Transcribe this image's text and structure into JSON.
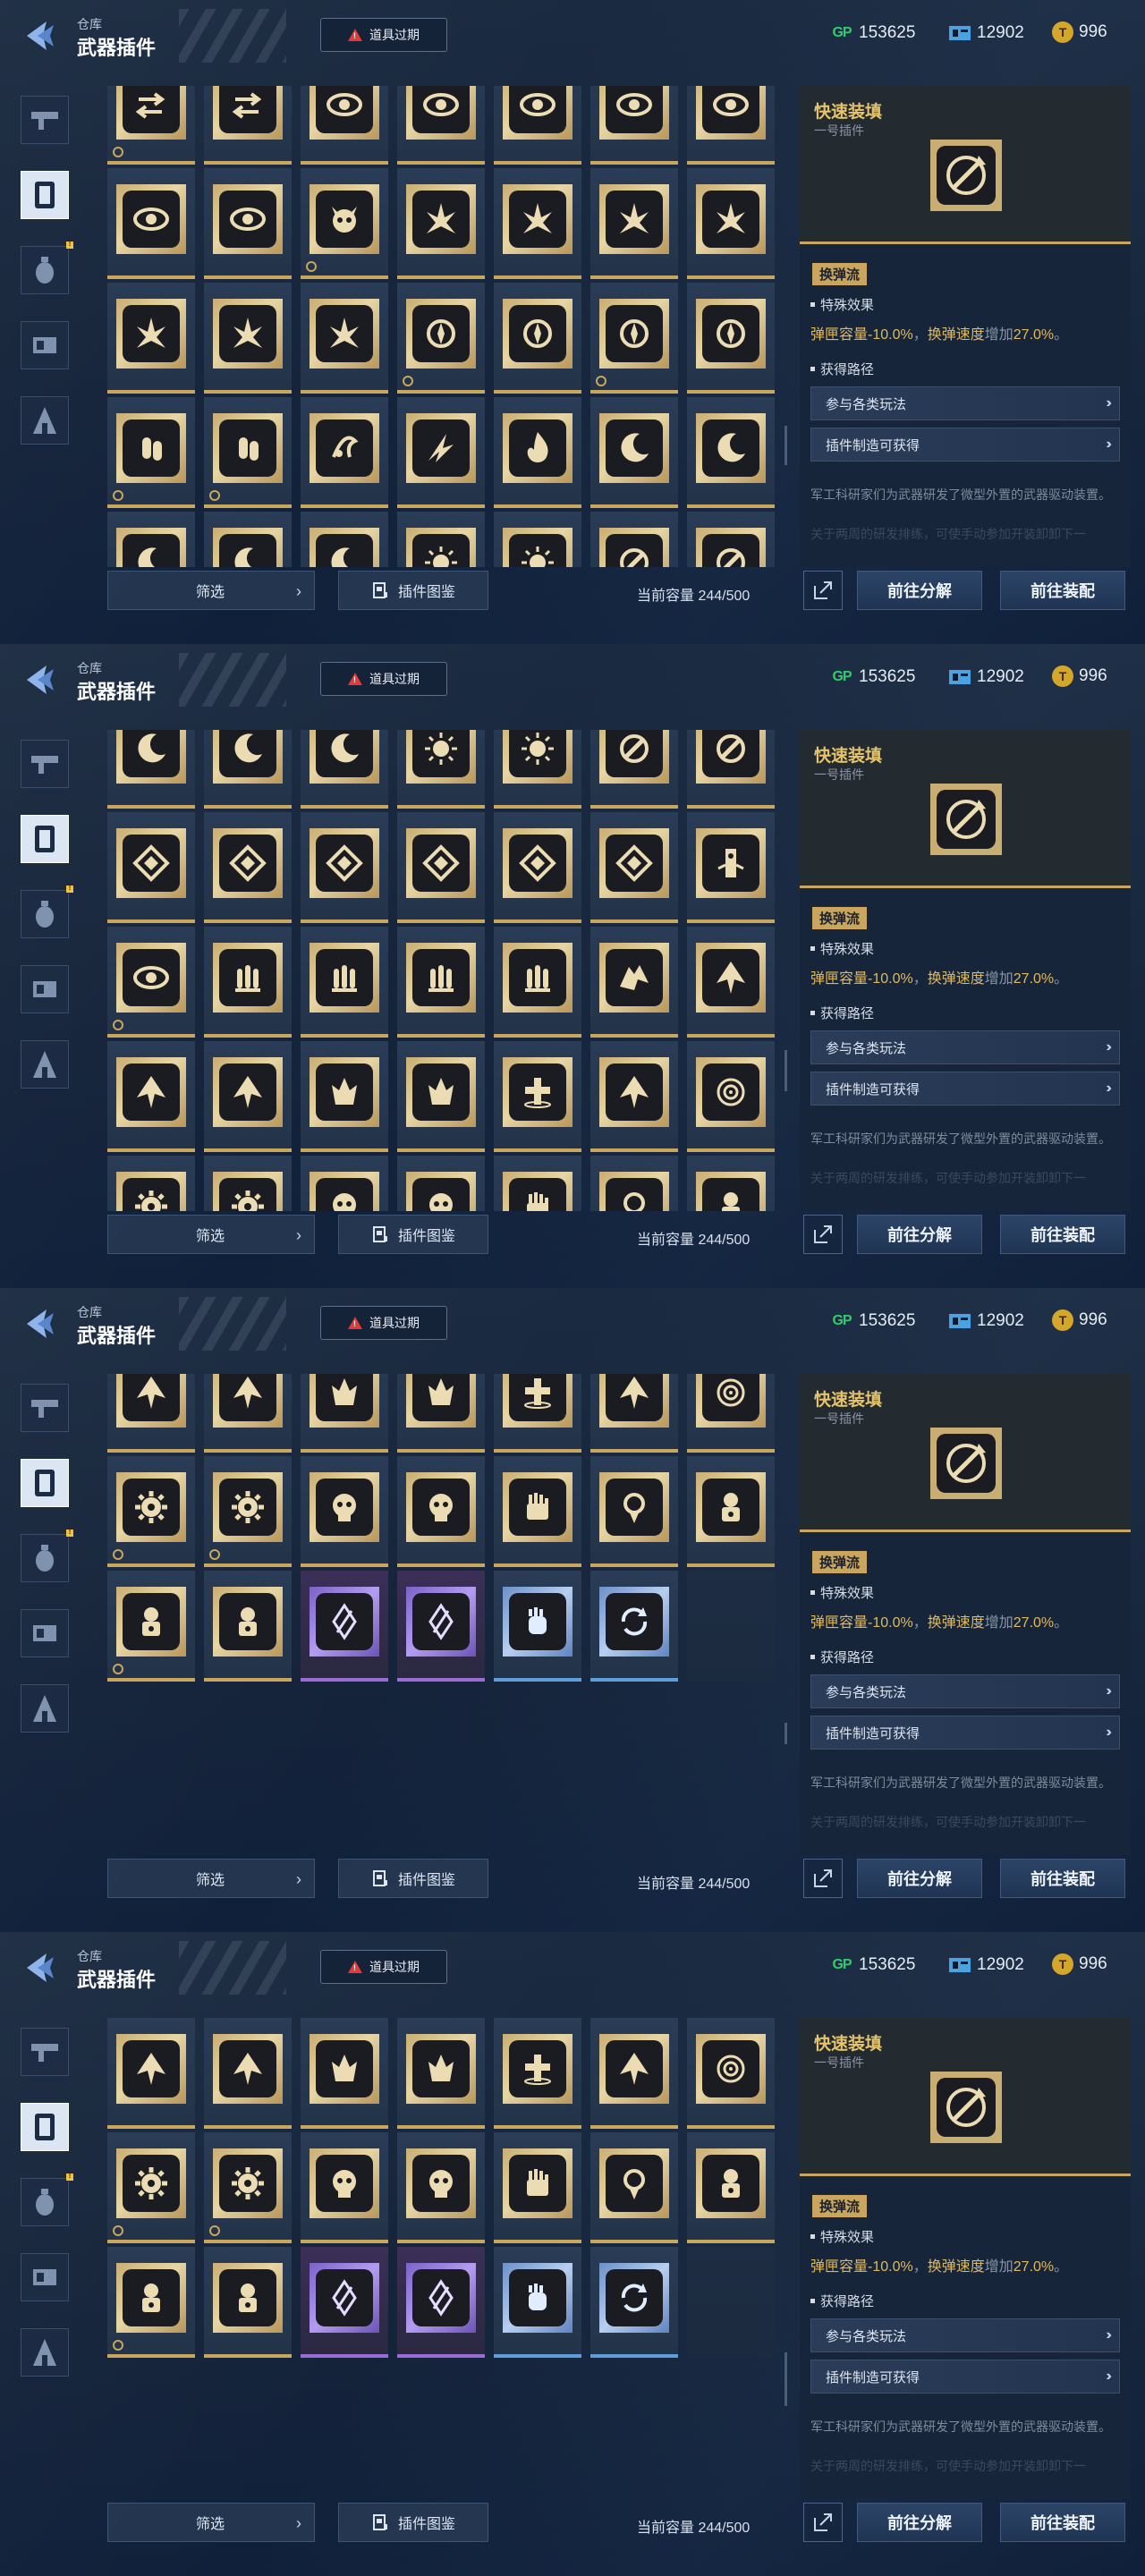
{
  "header": {
    "breadcrumb": "仓库",
    "title": "武器插件",
    "warning": "道具过期",
    "currencies": [
      {
        "icon": "gp-icon",
        "label": "GP",
        "value": "153625"
      },
      {
        "icon": "ticket-icon",
        "value": "12902"
      },
      {
        "icon": "coin-icon",
        "label": "T",
        "value": "996"
      }
    ]
  },
  "sidebar": {
    "categories": [
      "gun-icon",
      "plugin-icon",
      "grenade-icon",
      "device-icon",
      "character-icon"
    ],
    "selected_index": 1,
    "badge_index": 2,
    "badge_text": "!"
  },
  "grid": {
    "columns": 7,
    "rows": [
      {
        "icons": [
          "arrows",
          "arrows",
          "eye",
          "eye",
          "eye",
          "eye",
          "eye"
        ],
        "locked": [
          true,
          false,
          false,
          false,
          false,
          false,
          false
        ]
      },
      {
        "icons": [
          "eye",
          "eye",
          "demon",
          "burst",
          "burst",
          "burst",
          "burst"
        ],
        "locked": [
          false,
          false,
          true,
          false,
          false,
          false,
          false
        ]
      },
      {
        "icons": [
          "burst",
          "burst",
          "burst",
          "compass",
          "compass",
          "compass",
          "compass"
        ],
        "locked": [
          false,
          false,
          false,
          true,
          false,
          true,
          false
        ]
      },
      {
        "icons": [
          "bullet",
          "bullet",
          "swirl",
          "blades",
          "flame",
          "crescent",
          "crescent"
        ],
        "locked": [
          true,
          true,
          false,
          false,
          false,
          false,
          false
        ]
      },
      {
        "icons": [
          "crescent",
          "crescent",
          "crescent",
          "spark",
          "spark",
          "wrench",
          "wrench"
        ],
        "locked": [
          false,
          false,
          false,
          false,
          false,
          false,
          false
        ]
      },
      {
        "icons": [
          "diamond",
          "diamond",
          "diamond",
          "diamond",
          "diamond",
          "diamond",
          "totem"
        ],
        "locked": [
          false,
          false,
          false,
          false,
          false,
          false,
          false
        ]
      },
      {
        "icons": [
          "eye",
          "triple",
          "triple",
          "triple",
          "triple",
          "beast",
          "arrow-up"
        ],
        "locked": [
          true,
          false,
          false,
          false,
          false,
          false,
          false
        ]
      },
      {
        "icons": [
          "arrow-up",
          "arrow-up",
          "fire",
          "fire",
          "cross",
          "arrow-up",
          "target"
        ],
        "locked": [
          false,
          false,
          false,
          false,
          false,
          false,
          false
        ]
      },
      {
        "icons": [
          "cog",
          "cog",
          "skull",
          "skull",
          "fist",
          "medal",
          "robot"
        ],
        "locked": [
          true,
          true,
          false,
          false,
          false,
          false,
          false
        ]
      },
      {
        "icons": [
          "robot",
          "robot",
          "crystal",
          "crystal",
          "hand",
          "cycle",
          ""
        ],
        "rarity": [
          "gold",
          "gold",
          "purple",
          "purple",
          "blue",
          "blue",
          "empty"
        ],
        "locked": [
          true,
          false,
          false,
          false,
          false,
          false,
          false
        ]
      }
    ],
    "visible_first_row": [
      0,
      4,
      7,
      7
    ]
  },
  "bottom": {
    "filter": "筛选",
    "atlas": "插件图鉴",
    "capacity": "当前容量 244/500",
    "decompose": "前往分解",
    "equip": "前往装配"
  },
  "detail": {
    "title": "快速装填",
    "subtitle": "一号插件",
    "tag": "换弹流",
    "effect_heading": "特殊效果",
    "effect": {
      "a": "弹匣容量",
      "b": "-10.0%",
      "c": "，",
      "d": "换弹速度",
      "e": "增加",
      "f": "27.0%",
      "g": "。"
    },
    "obtain_heading": "获得路径",
    "obtain": [
      "参与各类玩法",
      "插件制造可获得"
    ],
    "description": "军工科研家们为武器研发了微型外置的武器驱动装置。",
    "description_faded": "关于两周的研发排练，可使手动参加开装卸卸下一",
    "accent": "#c9a55d",
    "highlight": "#e0b95a"
  }
}
